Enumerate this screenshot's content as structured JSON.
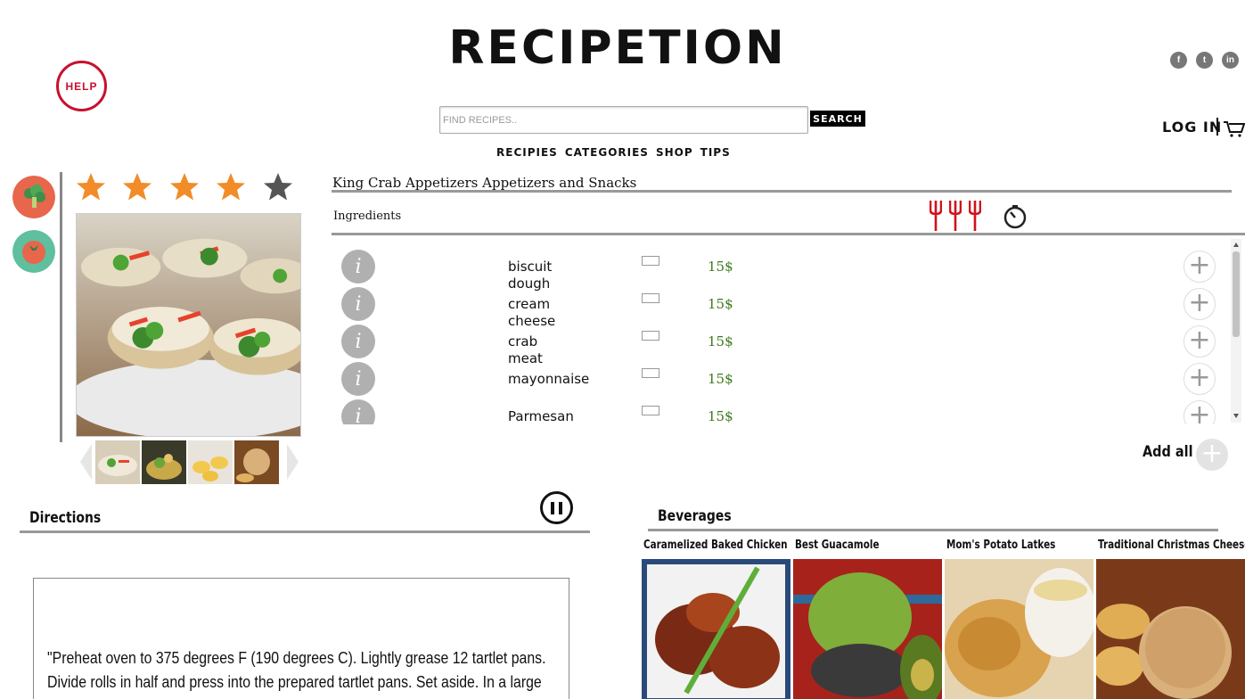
{
  "header": {
    "help_label": "HELP",
    "logo_text": "RECIPETION",
    "social": [
      {
        "icon": "facebook-icon",
        "glyph": "f"
      },
      {
        "icon": "twitter-icon",
        "glyph": "t"
      },
      {
        "icon": "linkedin-icon",
        "glyph": "in"
      }
    ],
    "search": {
      "placeholder": "FIND RECIPES..",
      "value": "",
      "button_label": "SEARCH"
    },
    "login_label": "LOG IN",
    "nav": [
      "RECIPIES",
      "CATEGORIES",
      "SHOP",
      "TIPS"
    ]
  },
  "side_icons": [
    {
      "icon": "broccoli-icon",
      "color": "#e8664b"
    },
    {
      "icon": "tomato-icon",
      "color": "#5fbf9f"
    }
  ],
  "rating": {
    "value": 4,
    "max": 5,
    "color_on": "#f28c28",
    "color_off": "#555555"
  },
  "recipe": {
    "title": "King Crab Appetizers Appetizers and Snacks",
    "ingredients_label": "Ingredients",
    "difficulty": 3,
    "ingredients": [
      {
        "name": "biscuit",
        "name2": "dough",
        "price": "15$"
      },
      {
        "name": "cream",
        "name2": "cheese",
        "price": "15$"
      },
      {
        "name": "crab",
        "name2": "meat",
        "price": "15$"
      },
      {
        "name": "mayonnaise",
        "name2": "",
        "price": "15$"
      },
      {
        "name": "Parmesan",
        "name2": "",
        "price": "15$"
      }
    ],
    "add_all_label": "Add all"
  },
  "directions": {
    "title": "Directions",
    "text": "\"Preheat oven to 375 degrees F (190 degrees C). Lightly grease 12 tartlet pans. Divide rolls in half and press into the prepared tartlet pans. Set aside. In a large bowl, combine cream"
  },
  "beverages": {
    "title": "Beverages",
    "items": [
      {
        "name": "Caramelized Baked Chicken"
      },
      {
        "name": "Best Guacamole"
      },
      {
        "name": "Mom's Potato Latkes"
      },
      {
        "name": "Traditional Christmas Cheese Ball"
      }
    ]
  },
  "colors": {
    "accent_red": "#c8102e",
    "price_green": "#3d7a1c"
  }
}
